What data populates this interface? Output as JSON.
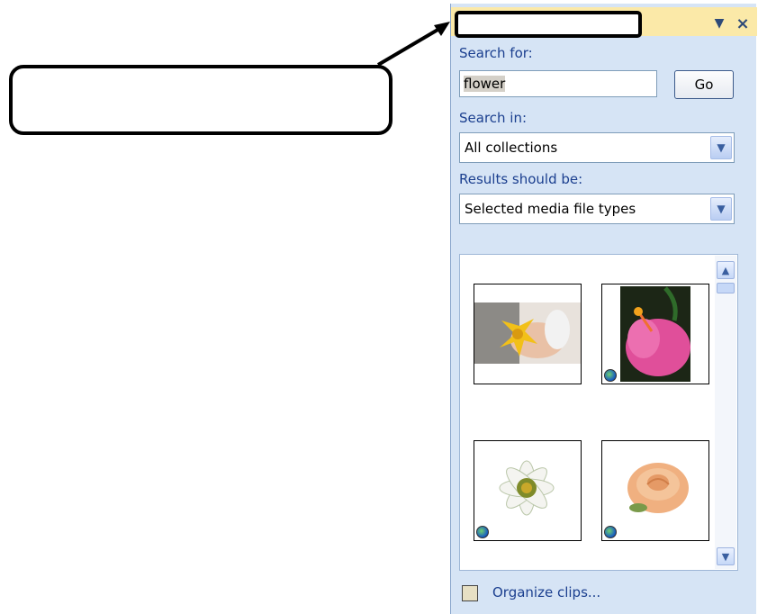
{
  "pane": {
    "title": "",
    "search_label": "Search for:",
    "search_value": "flower",
    "go_label": "Go",
    "search_in_label": "Search in:",
    "search_in_value": "All collections",
    "results_label": "Results should be:",
    "results_value": "Selected media file types",
    "organize_label": "Organize clips...",
    "thumbnails": [
      {
        "name": "hand-holding-yellow-flower"
      },
      {
        "name": "pink-hibiscus-flower"
      },
      {
        "name": "white-flower"
      },
      {
        "name": "peach-rose"
      }
    ]
  },
  "callout": {
    "text": ""
  },
  "colors": {
    "pane_bg": "#d6e4f5",
    "header_bg": "#fbe9a8",
    "label_blue": "#1b3f8f"
  }
}
